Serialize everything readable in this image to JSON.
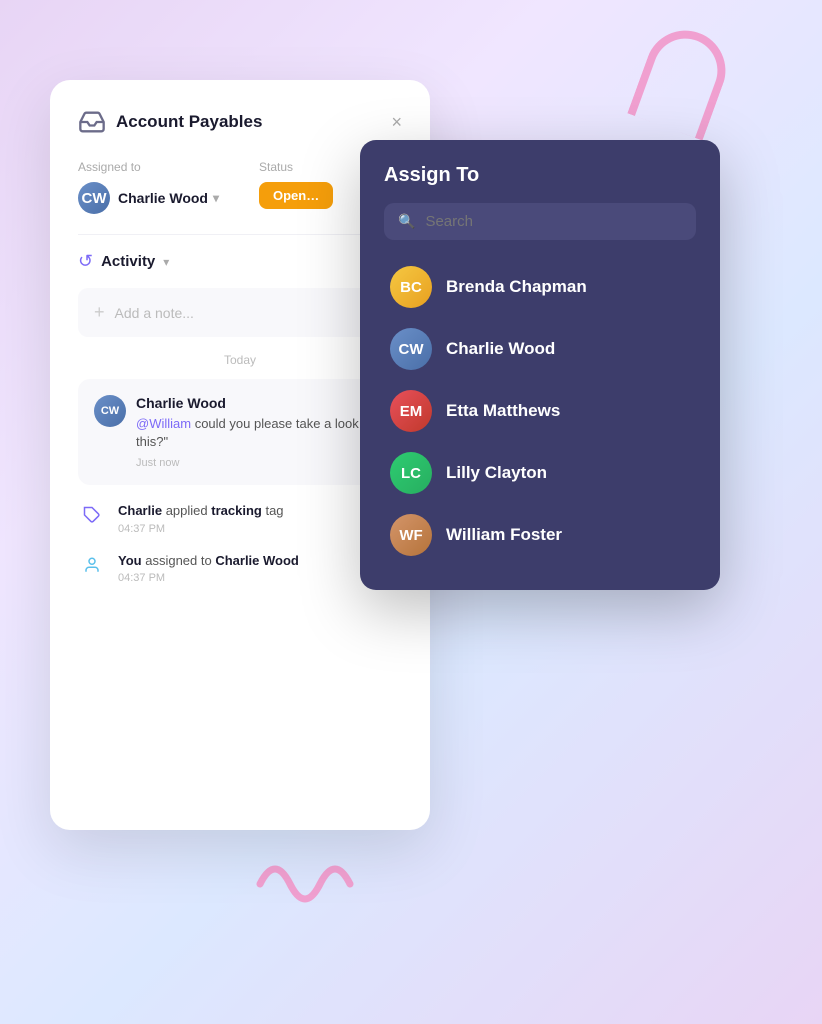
{
  "background": {
    "gradient_start": "#e8d5f5",
    "gradient_end": "#dce8ff"
  },
  "main_card": {
    "title": "Account Payables",
    "close_label": "×",
    "assigned_to_label": "Assigned to",
    "status_label": "Status",
    "user_name": "Charlie Wood",
    "status_badge": "Open",
    "activity_title": "Activity",
    "add_note_placeholder": "Add a note...",
    "today_label": "Today",
    "comment": {
      "author": "Charlie Wood",
      "mention": "@William",
      "text": " could you please take a look at this?\"",
      "time": "Just now"
    },
    "activity_items": [
      {
        "user": "Charlie",
        "action": " applied ",
        "highlight": "tracking",
        "action2": " tag",
        "time": "04:37 PM",
        "icon": "tag"
      },
      {
        "user": "You",
        "action": " assigned to ",
        "highlight": "Charlie Wood",
        "action2": "",
        "time": "04:37 PM",
        "icon": "person"
      }
    ]
  },
  "assign_dropdown": {
    "title": "Assign To",
    "search_placeholder": "Search",
    "people": [
      {
        "name": "Brenda Chapman",
        "initials": "BC",
        "avatar_class": "avatar-brenda"
      },
      {
        "name": "Charlie Wood",
        "initials": "CW",
        "avatar_class": "avatar-charlie2"
      },
      {
        "name": "Etta Matthews",
        "initials": "EM",
        "avatar_class": "avatar-etta"
      },
      {
        "name": "Lilly Clayton",
        "initials": "LC",
        "avatar_class": "avatar-lilly"
      },
      {
        "name": "William Foster",
        "initials": "WF",
        "avatar_class": "avatar-william"
      }
    ]
  }
}
